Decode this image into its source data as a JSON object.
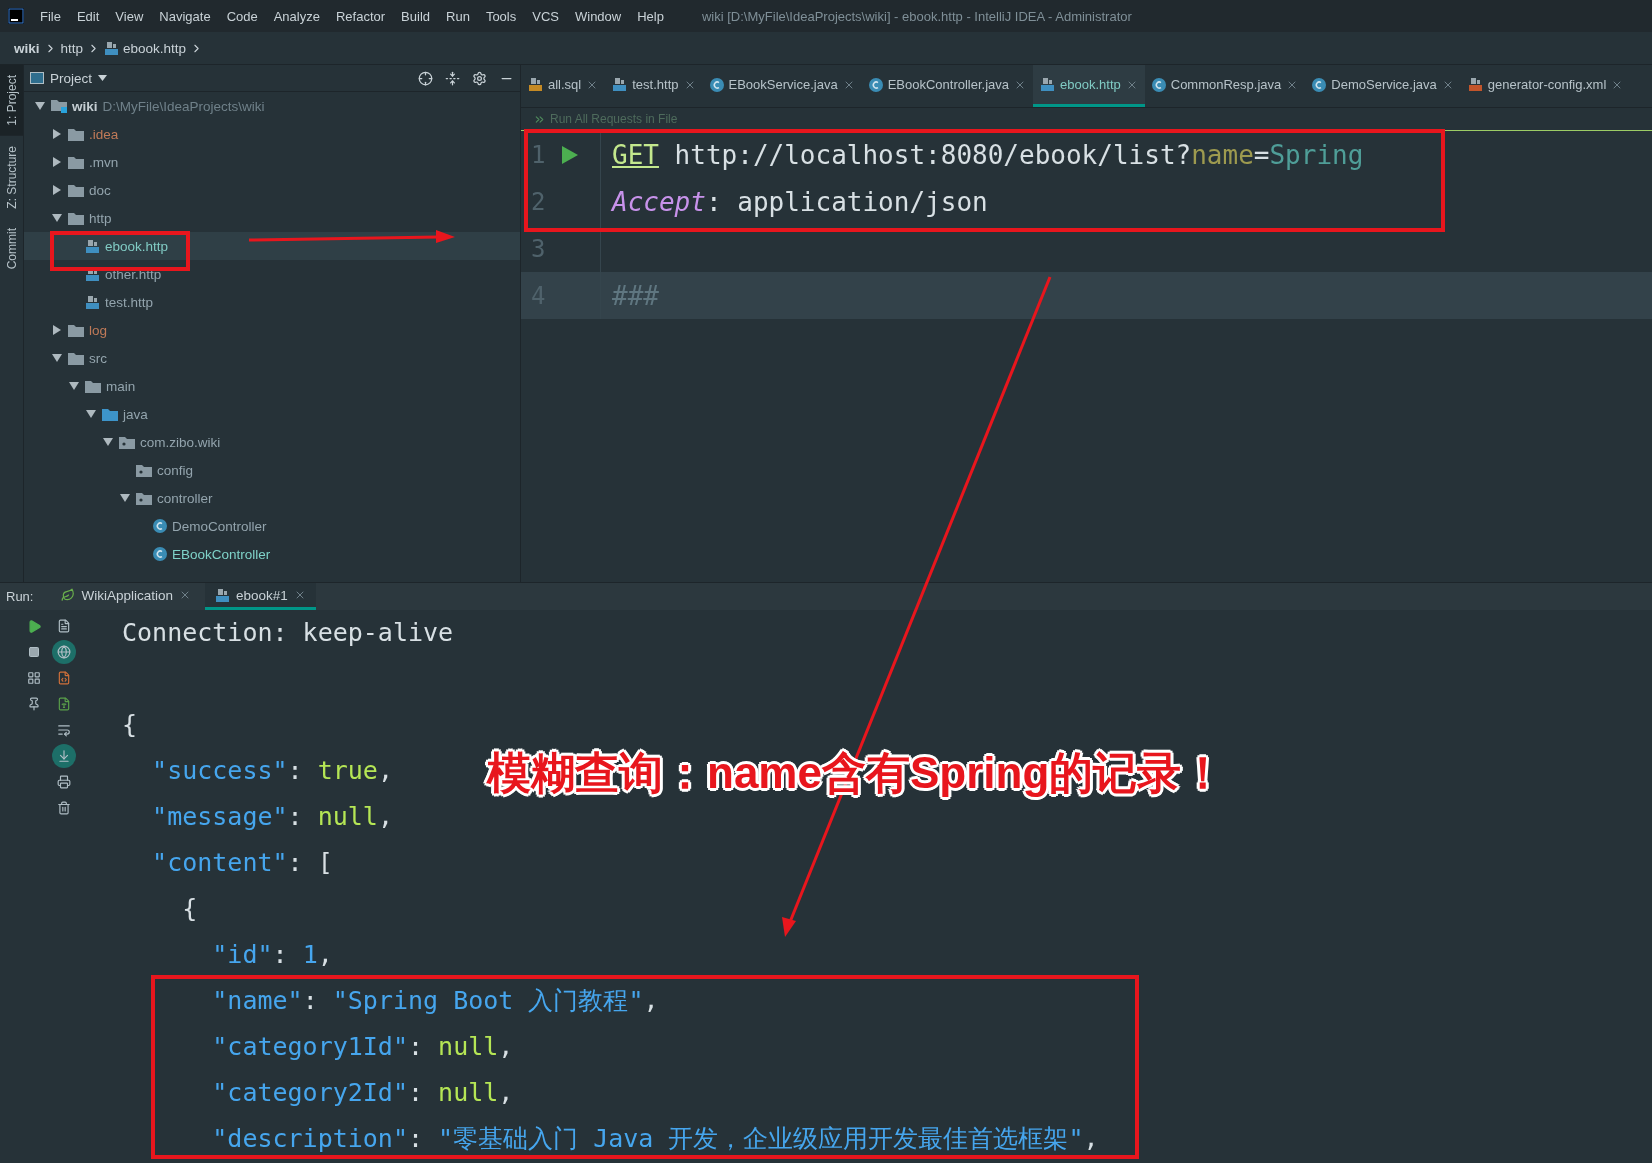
{
  "menu_bar": {
    "items": [
      "File",
      "Edit",
      "View",
      "Navigate",
      "Code",
      "Analyze",
      "Refactor",
      "Build",
      "Run",
      "Tools",
      "VCS",
      "Window",
      "Help"
    ],
    "title": "wiki [D:\\MyFile\\IdeaProjects\\wiki] - ebook.http - IntelliJ IDEA - Administrator"
  },
  "breadcrumb": [
    {
      "label": "wiki",
      "kind": "module"
    },
    {
      "label": "http",
      "kind": "folder"
    },
    {
      "label": "ebook.http",
      "kind": "http"
    }
  ],
  "tool_strip": [
    {
      "label": "1: Project",
      "selected": true
    },
    {
      "label": "Z: Structure",
      "selected": false
    },
    {
      "label": "Commit",
      "selected": false
    }
  ],
  "project_panel": {
    "title": "Project",
    "tree": [
      {
        "name": "wiki",
        "path": "D:\\MyFile\\IdeaProjects\\wiki",
        "kind": "module",
        "expanded": true,
        "selected": false,
        "color": "#c5ced3",
        "children": [
          {
            "name": ".idea",
            "kind": "folder",
            "expanded": false,
            "selected": false,
            "color": "#c07a58"
          },
          {
            "name": ".mvn",
            "kind": "folder",
            "expanded": false,
            "selected": false,
            "color": "#93a4ad"
          },
          {
            "name": "doc",
            "kind": "folder",
            "expanded": false,
            "selected": false,
            "color": "#93a4ad"
          },
          {
            "name": "http",
            "kind": "folder",
            "expanded": true,
            "selected": false,
            "color": "#93a4ad",
            "children": [
              {
                "name": "ebook.http",
                "kind": "http",
                "selected": true,
                "color": "#80cbc4"
              },
              {
                "name": "other.http",
                "kind": "http",
                "selected": false,
                "color": "#93a4ad"
              },
              {
                "name": "test.http",
                "kind": "http",
                "selected": false,
                "color": "#93a4ad"
              }
            ]
          },
          {
            "name": "log",
            "kind": "folder",
            "expanded": false,
            "selected": false,
            "color": "#c07a58"
          },
          {
            "name": "src",
            "kind": "folder",
            "expanded": true,
            "selected": false,
            "color": "#93a4ad",
            "children": [
              {
                "name": "main",
                "kind": "folder",
                "expanded": true,
                "selected": false,
                "color": "#93a4ad",
                "children": [
                  {
                    "name": "java",
                    "kind": "source",
                    "expanded": true,
                    "selected": false,
                    "color": "#93a4ad",
                    "children": [
                      {
                        "name": "com.zibo.wiki",
                        "kind": "package",
                        "expanded": true,
                        "selected": false,
                        "color": "#93a4ad",
                        "children": [
                          {
                            "name": "config",
                            "kind": "package",
                            "selected": false,
                            "color": "#93a4ad"
                          },
                          {
                            "name": "controller",
                            "kind": "package",
                            "expanded": true,
                            "selected": false,
                            "color": "#93a4ad",
                            "children": [
                              {
                                "name": "DemoController",
                                "kind": "class",
                                "selected": false,
                                "color": "#93a4ad"
                              },
                              {
                                "name": "EBookController",
                                "kind": "class",
                                "selected": false,
                                "color": "#7fd3c9"
                              }
                            ]
                          }
                        ]
                      }
                    ]
                  }
                ]
              }
            ]
          }
        ]
      }
    ]
  },
  "editor": {
    "tabs": [
      {
        "label": "all.sql",
        "kind": "sql",
        "selected": false
      },
      {
        "label": "test.http",
        "kind": "http",
        "selected": false
      },
      {
        "label": "EBookService.java",
        "kind": "class",
        "selected": false
      },
      {
        "label": "EBookController.java",
        "kind": "class",
        "selected": false
      },
      {
        "label": "ebook.http",
        "kind": "http",
        "selected": true
      },
      {
        "label": "CommonResp.java",
        "kind": "class",
        "selected": false
      },
      {
        "label": "DemoService.java",
        "kind": "class",
        "selected": false
      },
      {
        "label": "generator-config.xml",
        "kind": "xml",
        "selected": false
      }
    ],
    "hint": "Run All Requests in File",
    "lines": [
      {
        "number": "1",
        "runnable": true,
        "current": false,
        "tokens": [
          {
            "kind": "method",
            "text": "GET"
          },
          {
            "kind": "plain",
            "text": " http://localhost:8080/ebook/list?"
          },
          {
            "kind": "param",
            "text": "name"
          },
          {
            "kind": "plain",
            "text": "="
          },
          {
            "kind": "value",
            "text": "Spring"
          }
        ]
      },
      {
        "number": "2",
        "runnable": false,
        "current": false,
        "tokens": [
          {
            "kind": "header",
            "text": "Accept"
          },
          {
            "kind": "plain",
            "text": ": application/json"
          }
        ]
      },
      {
        "number": "3",
        "runnable": false,
        "current": false
      },
      {
        "number": "4",
        "runnable": false,
        "current": true,
        "tokens": [
          {
            "kind": "comment",
            "text": "###"
          }
        ]
      }
    ]
  },
  "run_panel": {
    "label": "Run:",
    "tabs": [
      {
        "label": "WikiApplication",
        "kind": "app",
        "selected": false
      },
      {
        "label": "ebook#1",
        "kind": "http",
        "selected": true
      }
    ],
    "output": [
      [
        {
          "kind": "plain",
          "text": "Connection: keep-alive"
        }
      ],
      [
        {
          "kind": "plain",
          "text": "{"
        }
      ],
      [
        {
          "kind": "key",
          "text": "  \"success\""
        },
        {
          "kind": "plain",
          "text": ": "
        },
        {
          "kind": "literal",
          "text": "true"
        },
        {
          "kind": "plain",
          "text": ","
        }
      ],
      [
        {
          "kind": "key",
          "text": "  \"message\""
        },
        {
          "kind": "plain",
          "text": ": "
        },
        {
          "kind": "literal",
          "text": "null"
        },
        {
          "kind": "plain",
          "text": ","
        }
      ],
      [
        {
          "kind": "key",
          "text": "  \"content\""
        },
        {
          "kind": "plain",
          "text": ": ["
        }
      ],
      [
        {
          "kind": "plain",
          "text": "    {"
        }
      ],
      [
        {
          "kind": "key",
          "text": "      \"id\""
        },
        {
          "kind": "plain",
          "text": ": "
        },
        {
          "kind": "number",
          "text": "1"
        },
        {
          "kind": "plain",
          "text": ","
        }
      ],
      [
        {
          "kind": "key",
          "text": "      \"name\""
        },
        {
          "kind": "plain",
          "text": ": "
        },
        {
          "kind": "string",
          "text": "\"Spring Boot 入门教程\""
        },
        {
          "kind": "plain",
          "text": ","
        }
      ],
      [
        {
          "kind": "key",
          "text": "      \"category1Id\""
        },
        {
          "kind": "plain",
          "text": ": "
        },
        {
          "kind": "literal",
          "text": "null"
        },
        {
          "kind": "plain",
          "text": ","
        }
      ],
      [
        {
          "kind": "key",
          "text": "      \"category2Id\""
        },
        {
          "kind": "plain",
          "text": ": "
        },
        {
          "kind": "literal",
          "text": "null"
        },
        {
          "kind": "plain",
          "text": ","
        }
      ],
      [
        {
          "kind": "key",
          "text": "      \"description\""
        },
        {
          "kind": "plain",
          "text": ": "
        },
        {
          "kind": "string",
          "text": "\"零基础入门 Java 开发，企业级应用开发最佳首选框架\""
        },
        {
          "kind": "plain",
          "text": ","
        }
      ]
    ]
  },
  "annotation": {
    "callout": "模糊查询：name含有Spring的记录！"
  }
}
